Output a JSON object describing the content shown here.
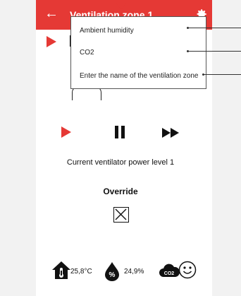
{
  "header": {
    "title": "Ventilation zone 1",
    "back_icon": "arrow-left-icon",
    "settings_icon": "gear-icon",
    "color": "#e53935"
  },
  "popup": {
    "items": [
      {
        "label": "Ambient humidity"
      },
      {
        "label": "CO2"
      },
      {
        "label": "Enter the name of the ventilation zone"
      }
    ]
  },
  "controls": {
    "play_icon": "play-icon",
    "pause_icon": "pause-icon",
    "fast_forward_icon": "fast-forward-icon"
  },
  "status": {
    "power_text": "Current ventilator power level 1"
  },
  "override": {
    "title": "Override",
    "checked": false
  },
  "sensors": {
    "temperature": "25,8°C",
    "humidity": "24,9%",
    "humidity_badge": "%",
    "co2_badge": "CO2"
  }
}
